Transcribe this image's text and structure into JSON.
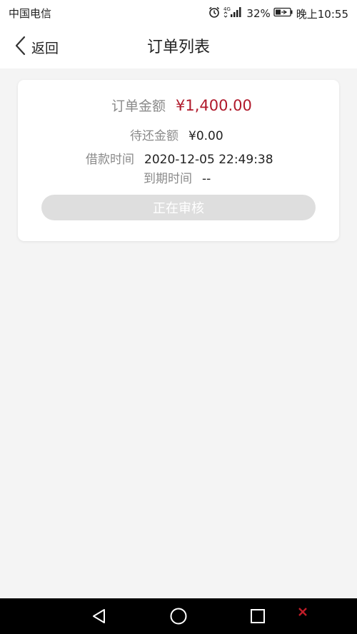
{
  "status_bar": {
    "carrier": "中国电信",
    "network": "4G",
    "battery": "32%",
    "time": "晚上10:55",
    "icons": [
      "alarm-icon",
      "signal-icon",
      "battery-icon"
    ]
  },
  "header": {
    "back_label": "返回",
    "title": "订单列表"
  },
  "order": {
    "amount_label": "订单金额",
    "amount_value": "¥1,400.00",
    "due_label": "待还金额",
    "due_value": "¥0.00",
    "loan_time_label": "借款时间",
    "loan_time_value": "2020-12-05 22:49:38",
    "expire_label": "到期时间",
    "expire_value": "--",
    "status_button": "正在审核"
  },
  "colors": {
    "accent_amount": "#b0192b",
    "button_disabled": "#dedede",
    "page_background": "#f4f4f4"
  },
  "nav_bar": {
    "icons": [
      "nav-back-icon",
      "nav-home-icon",
      "nav-recent-icon"
    ]
  }
}
